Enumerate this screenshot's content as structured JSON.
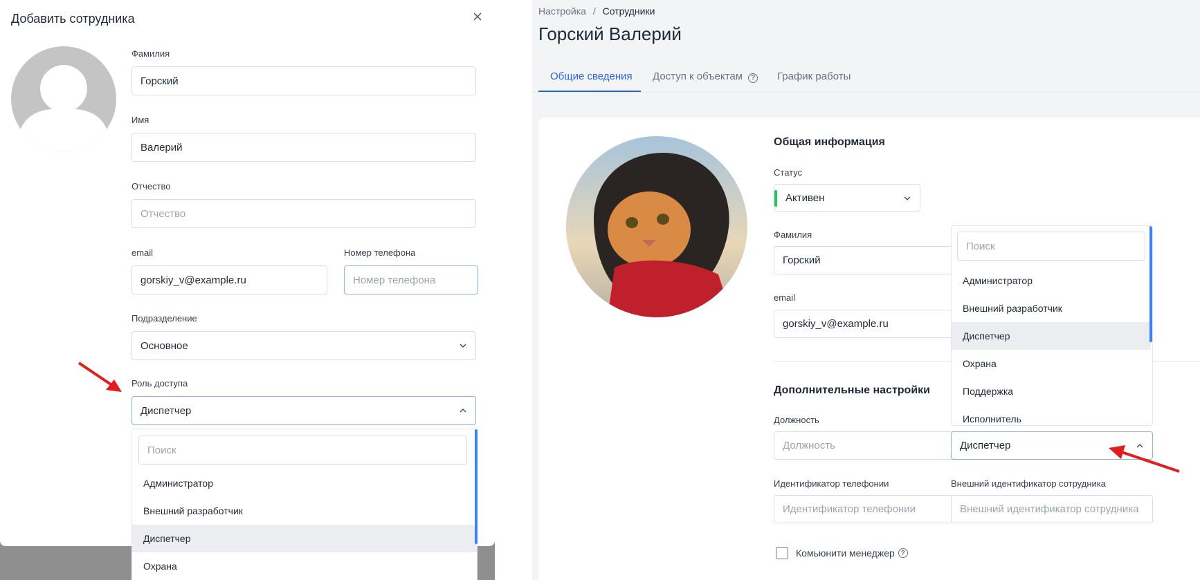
{
  "modal": {
    "title": "Добавить сотрудника",
    "fields": {
      "lastname_label": "Фамилия",
      "lastname_value": "Горский",
      "firstname_label": "Имя",
      "firstname_value": "Валерий",
      "middlename_label": "Отчество",
      "middlename_placeholder": "Отчество",
      "email_label": "email",
      "email_value": "gorskiy_v@example.ru",
      "phone_label": "Номер телефона",
      "phone_placeholder": "Номер телефона",
      "department_label": "Подразделение",
      "department_value": "Основное",
      "role_label": "Роль доступа",
      "role_value": "Диспетчер"
    },
    "role_dropdown": {
      "search_placeholder": "Поиск",
      "options": [
        "Администратор",
        "Внешний разработчик",
        "Диспетчер",
        "Охрана"
      ],
      "selected": "Диспетчер"
    }
  },
  "page": {
    "breadcrumb": {
      "parent": "Настройка",
      "separator": "/",
      "current": "Сотрудники"
    },
    "title": "Горский Валерий",
    "tabs": [
      "Общие сведения",
      "Доступ к объектам",
      "График работы"
    ],
    "active_tab": "Общие сведения",
    "general": {
      "section_title": "Общая информация",
      "status_label": "Статус",
      "status_value": "Активен",
      "lastname_label": "Фамилия",
      "lastname_value": "Горский",
      "email_label": "email",
      "email_value": "gorskiy_v@example.ru"
    },
    "extra": {
      "section_title": "Дополнительные настройки",
      "position_label": "Должность",
      "position_placeholder": "Должность",
      "role_value": "Диспетчер",
      "telephony_label": "Идентификатор телефонии",
      "telephony_placeholder": "Идентификатор телефонии",
      "external_id_label": "Внешний идентификатор сотрудника",
      "external_id_placeholder": "Внешний идентификатор сотрудника",
      "community_manager_label": "Комьюнити менеджер"
    },
    "role_dropdown": {
      "search_placeholder": "Поиск",
      "options": [
        "Администратор",
        "Внешний разработчик",
        "Диспетчер",
        "Охрана",
        "Поддержка",
        "Исполнитель"
      ],
      "selected": "Диспетчер"
    }
  },
  "colors": {
    "accent": "#2563eb",
    "status_active": "#22c55e",
    "arrow": "#e11d1d",
    "selected_bg": "#ebedf0"
  },
  "icons": [
    "close-icon",
    "chevron-down-icon",
    "chevron-up-icon",
    "help-icon",
    "arrow-annotation-icon",
    "avatar-placeholder-icon"
  ]
}
